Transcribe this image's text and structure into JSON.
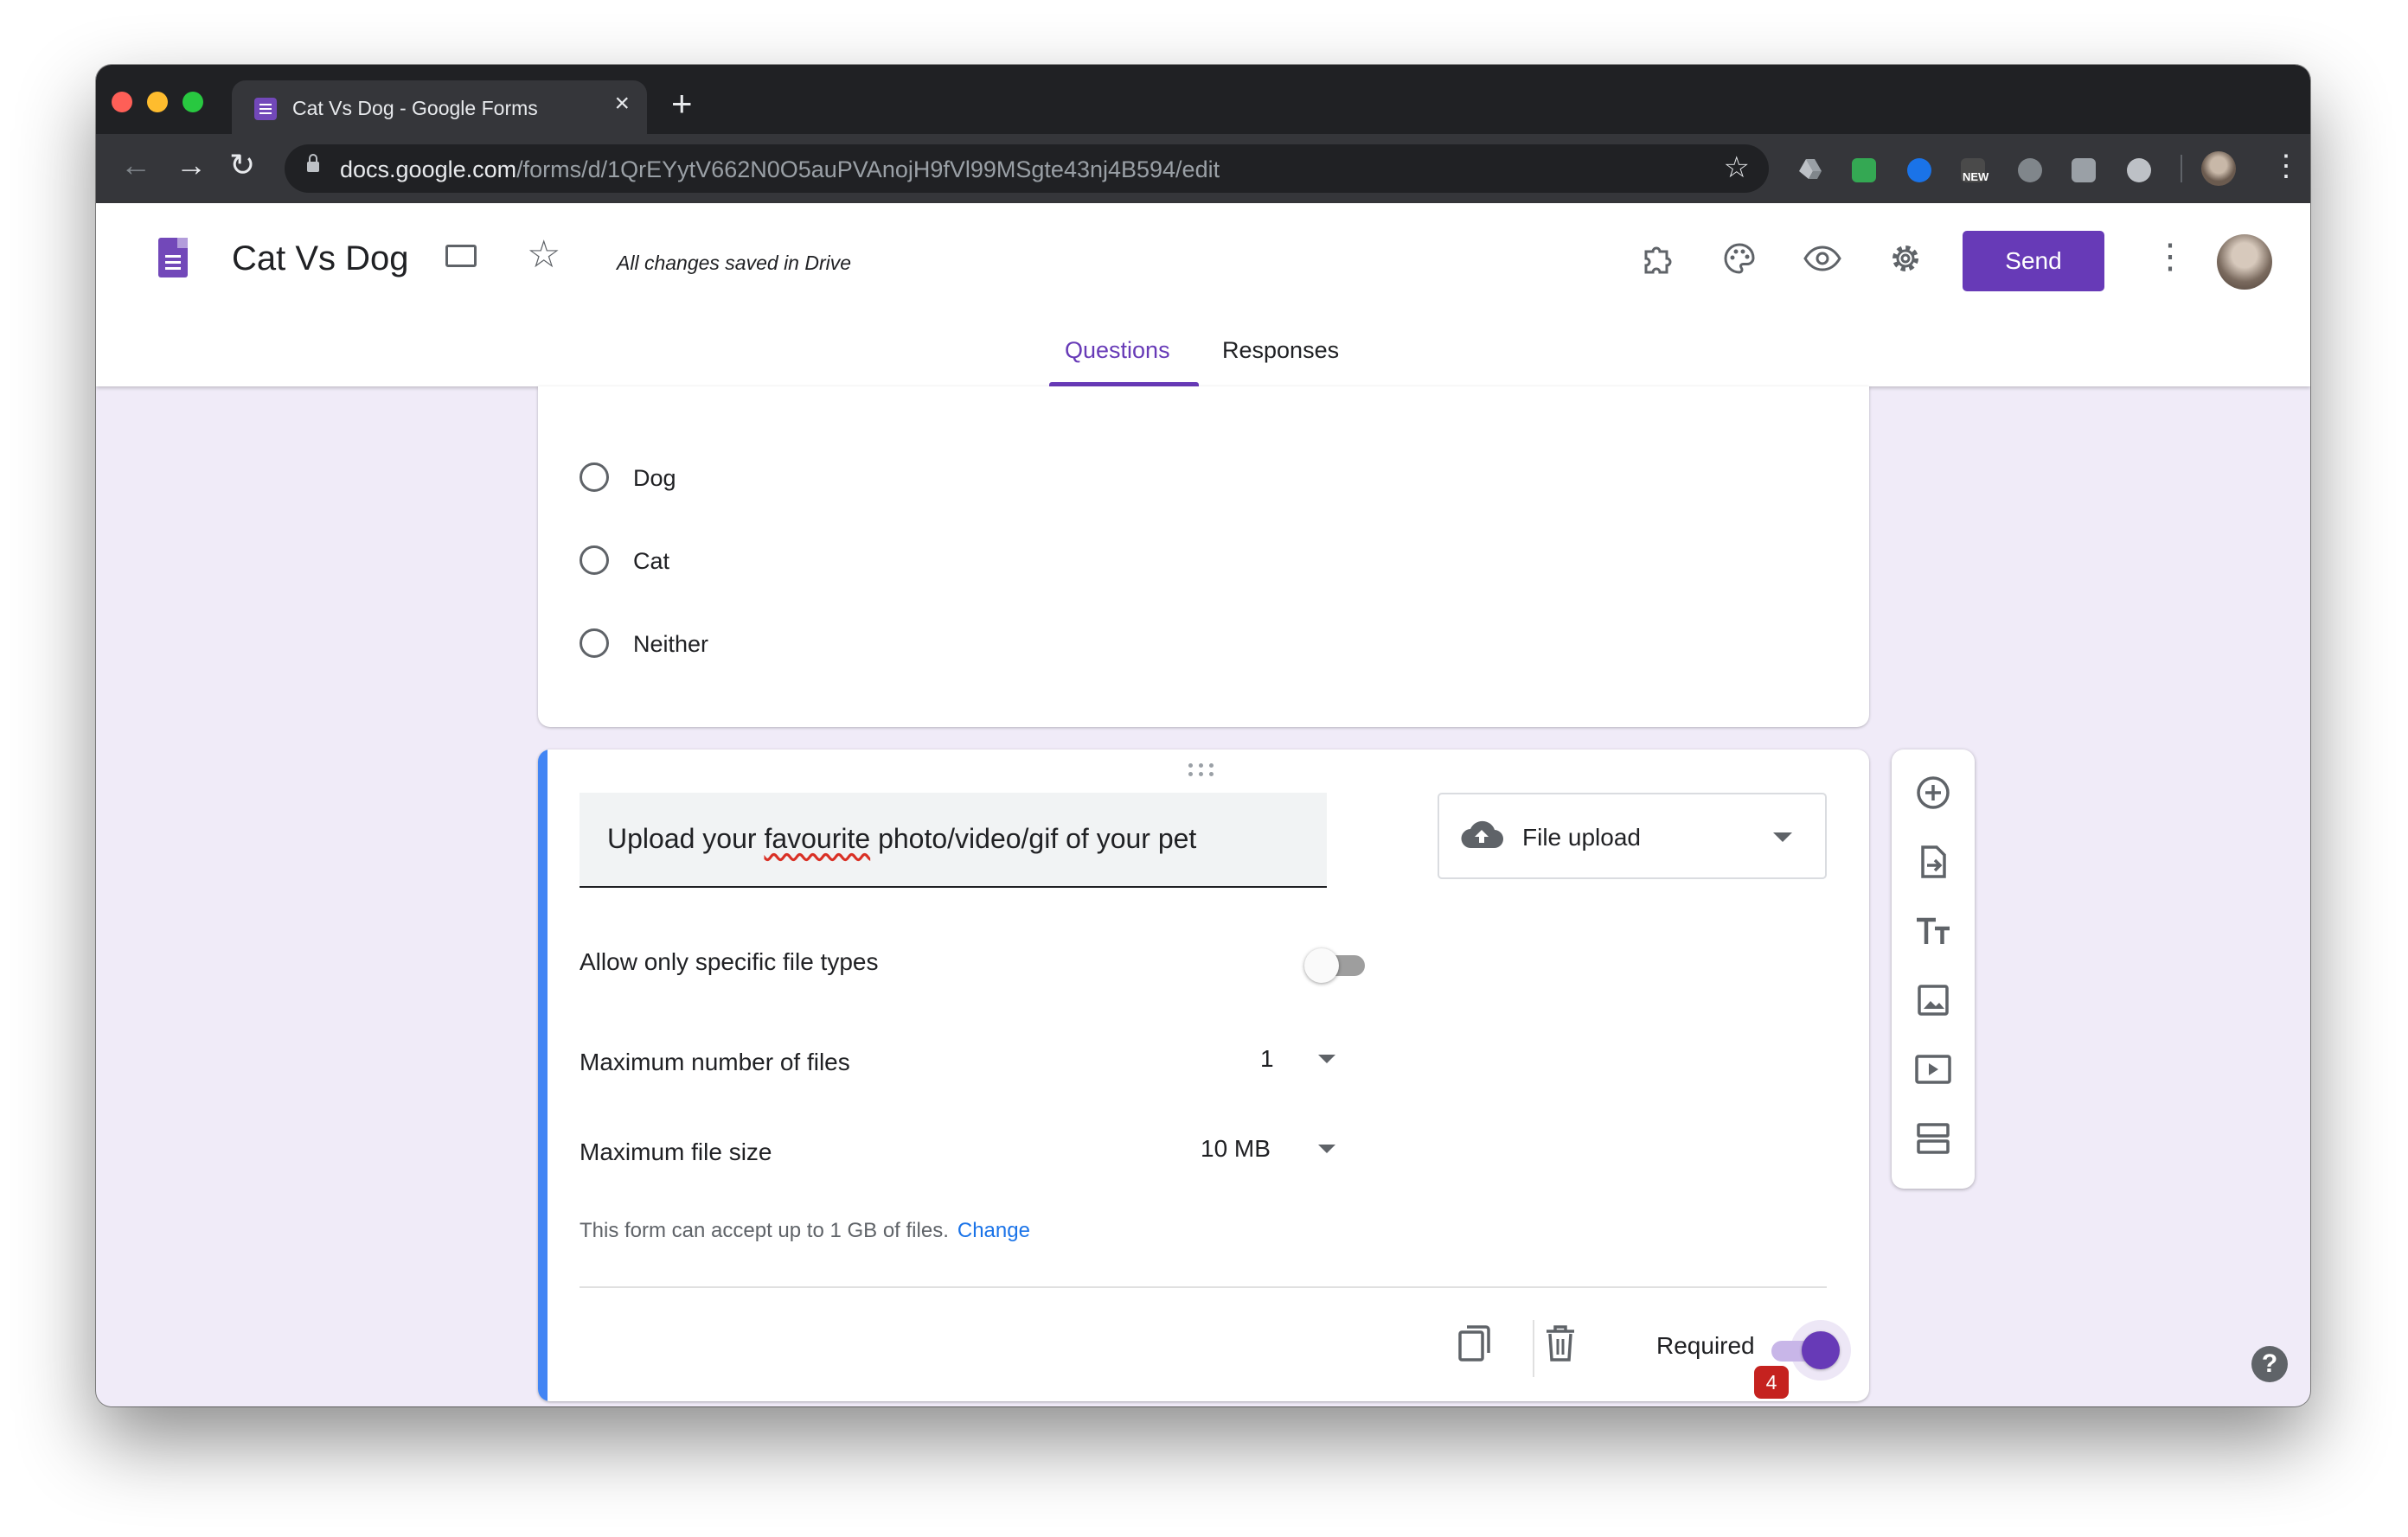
{
  "browser": {
    "tab_title": "Cat Vs Dog - Google Forms",
    "tab_close": "×",
    "new_tab": "+",
    "url_domain": "docs.google.com",
    "url_path": "/forms/d/1QrEYytV662N0O5auPVAnojH9fVl99MSgte43nj4B594/edit",
    "ext_new_label": "NEW",
    "back": "←",
    "forward": "→",
    "reload": "↻",
    "bookmark_star": "☆",
    "menu": "⋮"
  },
  "header": {
    "form_title": "Cat Vs Dog",
    "save_status": "All changes saved in Drive",
    "send_label": "Send",
    "star": "☆",
    "menu": "⋮",
    "tabs": {
      "questions": "Questions",
      "responses": "Responses"
    },
    "icons": [
      "folder-icon",
      "star-icon",
      "addons-icon",
      "palette-icon",
      "preview-icon",
      "settings-icon"
    ]
  },
  "prev_question": {
    "options": [
      "Dog",
      "Cat",
      "Neither"
    ]
  },
  "question": {
    "title_before": "Upload your ",
    "title_misspelled": "favourite",
    "title_after": " photo/video/gif of your pet",
    "type": "File upload",
    "allow_specific_label": "Allow only specific file types",
    "allow_specific_on": false,
    "max_files_label": "Maximum number of files",
    "max_files_value": "1",
    "max_size_label": "Maximum file size",
    "max_size_value": "10 MB",
    "accept_note": "This form can accept up to 1 GB of files.",
    "change_link": "Change",
    "required_label": "Required",
    "required_on": true,
    "badge": "4",
    "menu": "⋮"
  },
  "sidebar_icons": [
    "add-question-icon",
    "import-questions-icon",
    "add-title-icon",
    "add-image-icon",
    "add-video-icon",
    "add-section-icon"
  ],
  "help": "?",
  "colors": {
    "accent": "#673ab7",
    "focus_bar": "#4285f4",
    "page_bg": "#f0ebf8",
    "badge": "#c5221f",
    "link": "#1a73e8"
  }
}
